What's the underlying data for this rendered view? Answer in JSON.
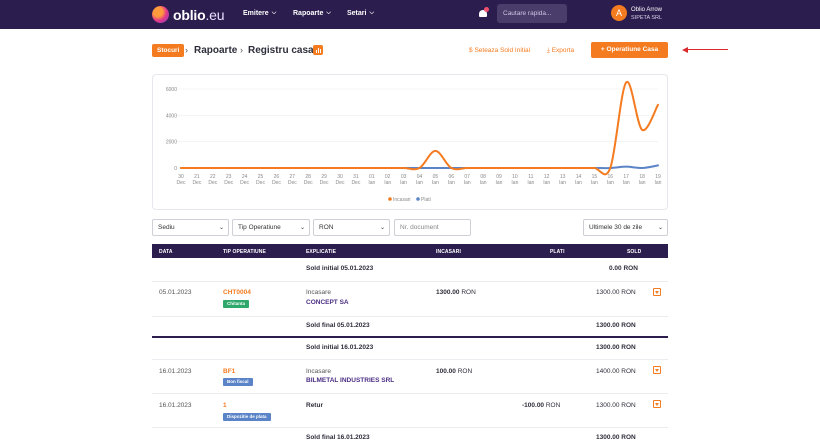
{
  "nav": {
    "brand": "oblio",
    "brand_tld": ".eu",
    "menus": [
      "Emitere",
      "Rapoarte",
      "Setari"
    ],
    "search_placeholder": "Cautare rapida...",
    "user_initial": "A",
    "user_name": "Oblio Arrow",
    "user_company": "SIPETA SRL"
  },
  "breadcrumb": {
    "badge": "Stocuri",
    "items": [
      "Rapoarte",
      "Registru casa"
    ]
  },
  "actions": {
    "initial_balance": "Seteaza Sold Initial",
    "export": "Exporta",
    "add_operation": "Operatiune Casa"
  },
  "chart_data": {
    "type": "line",
    "categories": [
      "30 Dec",
      "31 Dec",
      "22 Dec",
      "23 Dec",
      "24 Dec",
      "25 Dec",
      "26 Dec",
      "27 Dec",
      "28 Dec",
      "29 Dec",
      "30 Dec",
      "31 Dec",
      "01 Ian",
      "02 Ian",
      "03 Ian",
      "04 Ian",
      "05 Ian",
      "06 Ian",
      "07 Ian",
      "08 Ian",
      "09 Ian",
      "10 Ian",
      "11 Ian",
      "12 Ian",
      "13 Ian",
      "14 Ian",
      "15 Ian",
      "16 Ian",
      "17 Ian",
      "18 Ian",
      "19 Ian"
    ],
    "x_top": [
      "30",
      "21",
      "22",
      "23",
      "24",
      "25",
      "26",
      "27",
      "28",
      "29",
      "30",
      "31",
      "01",
      "02",
      "03",
      "04",
      "05",
      "06",
      "07",
      "08",
      "09",
      "10",
      "11",
      "12",
      "13",
      "14",
      "15",
      "16",
      "17",
      "18",
      "19"
    ],
    "x_bottom": [
      "Dec",
      "Dec",
      "Dec",
      "Dec",
      "Dec",
      "Dec",
      "Dec",
      "Dec",
      "Dec",
      "Dec",
      "Dec",
      "Dec",
      "Ian",
      "Ian",
      "Ian",
      "Ian",
      "Ian",
      "Ian",
      "Ian",
      "Ian",
      "Ian",
      "Ian",
      "Ian",
      "Ian",
      "Ian",
      "Ian",
      "Ian",
      "Ian",
      "Ian",
      "Ian",
      "Ian"
    ],
    "yticks": [
      "6000",
      "4000",
      "2000",
      "0"
    ],
    "ylim": [
      0,
      6000
    ],
    "grid": true,
    "legend_position": "bottom",
    "series": [
      {
        "name": "Incasari",
        "color": "#f47b20",
        "values": [
          0,
          0,
          0,
          0,
          0,
          0,
          0,
          0,
          0,
          0,
          0,
          0,
          0,
          0,
          0,
          0,
          1300,
          0,
          0,
          0,
          0,
          0,
          0,
          0,
          0,
          0,
          0,
          0,
          6500,
          2900,
          4800
        ]
      },
      {
        "name": "Plati",
        "color": "#5a84c7",
        "values": [
          0,
          0,
          0,
          0,
          0,
          0,
          0,
          0,
          0,
          0,
          0,
          0,
          0,
          0,
          0,
          0,
          0,
          0,
          0,
          0,
          0,
          0,
          0,
          0,
          0,
          0,
          0,
          0,
          100,
          0,
          200
        ]
      }
    ]
  },
  "filters": {
    "sediu": "Sediu",
    "tip": "Tip Operatiune",
    "moneda": "RON",
    "document_placeholder": "Nr. document",
    "period": "Ultimele 30 de zile"
  },
  "table": {
    "headers": [
      "DATA",
      "TIP OPERATIUNE",
      "EXPLICATIE",
      "INCASARI",
      "PLATI",
      "SOLD"
    ],
    "rows": {
      "r1": {
        "label": "Sold initial 05.01.2023",
        "sold": "0.00 RON"
      },
      "r2": {
        "date": "05.01.2023",
        "doc": "CHT0004",
        "tag": "Chitanta",
        "type": "Incasare",
        "party": "CONCEPT SA",
        "incasari": "1300.00",
        "currency": "RON",
        "sold": "1300.00 RON"
      },
      "r3": {
        "label": "Sold final 05.01.2023",
        "sold": "1300.00 RON"
      },
      "r4": {
        "label": "Sold initial 16.01.2023",
        "sold": "1300.00 RON"
      },
      "r5": {
        "date": "16.01.2023",
        "doc": "BF1",
        "tag": "Bon fiscal",
        "type": "Incasare",
        "party": "BILMETAL INDUSTRIES SRL",
        "incasari": "100.00",
        "currency": "RON",
        "sold": "1400.00 RON"
      },
      "r6": {
        "date": "16.01.2023",
        "doc": "1",
        "tag": "Dispozitie de plata",
        "type": "Retur",
        "plati": "-100.00",
        "currency": "RON",
        "sold": "1300.00 RON"
      },
      "r7": {
        "label": "Sold final 16.01.2023",
        "sold": "1300.00 RON"
      }
    }
  }
}
